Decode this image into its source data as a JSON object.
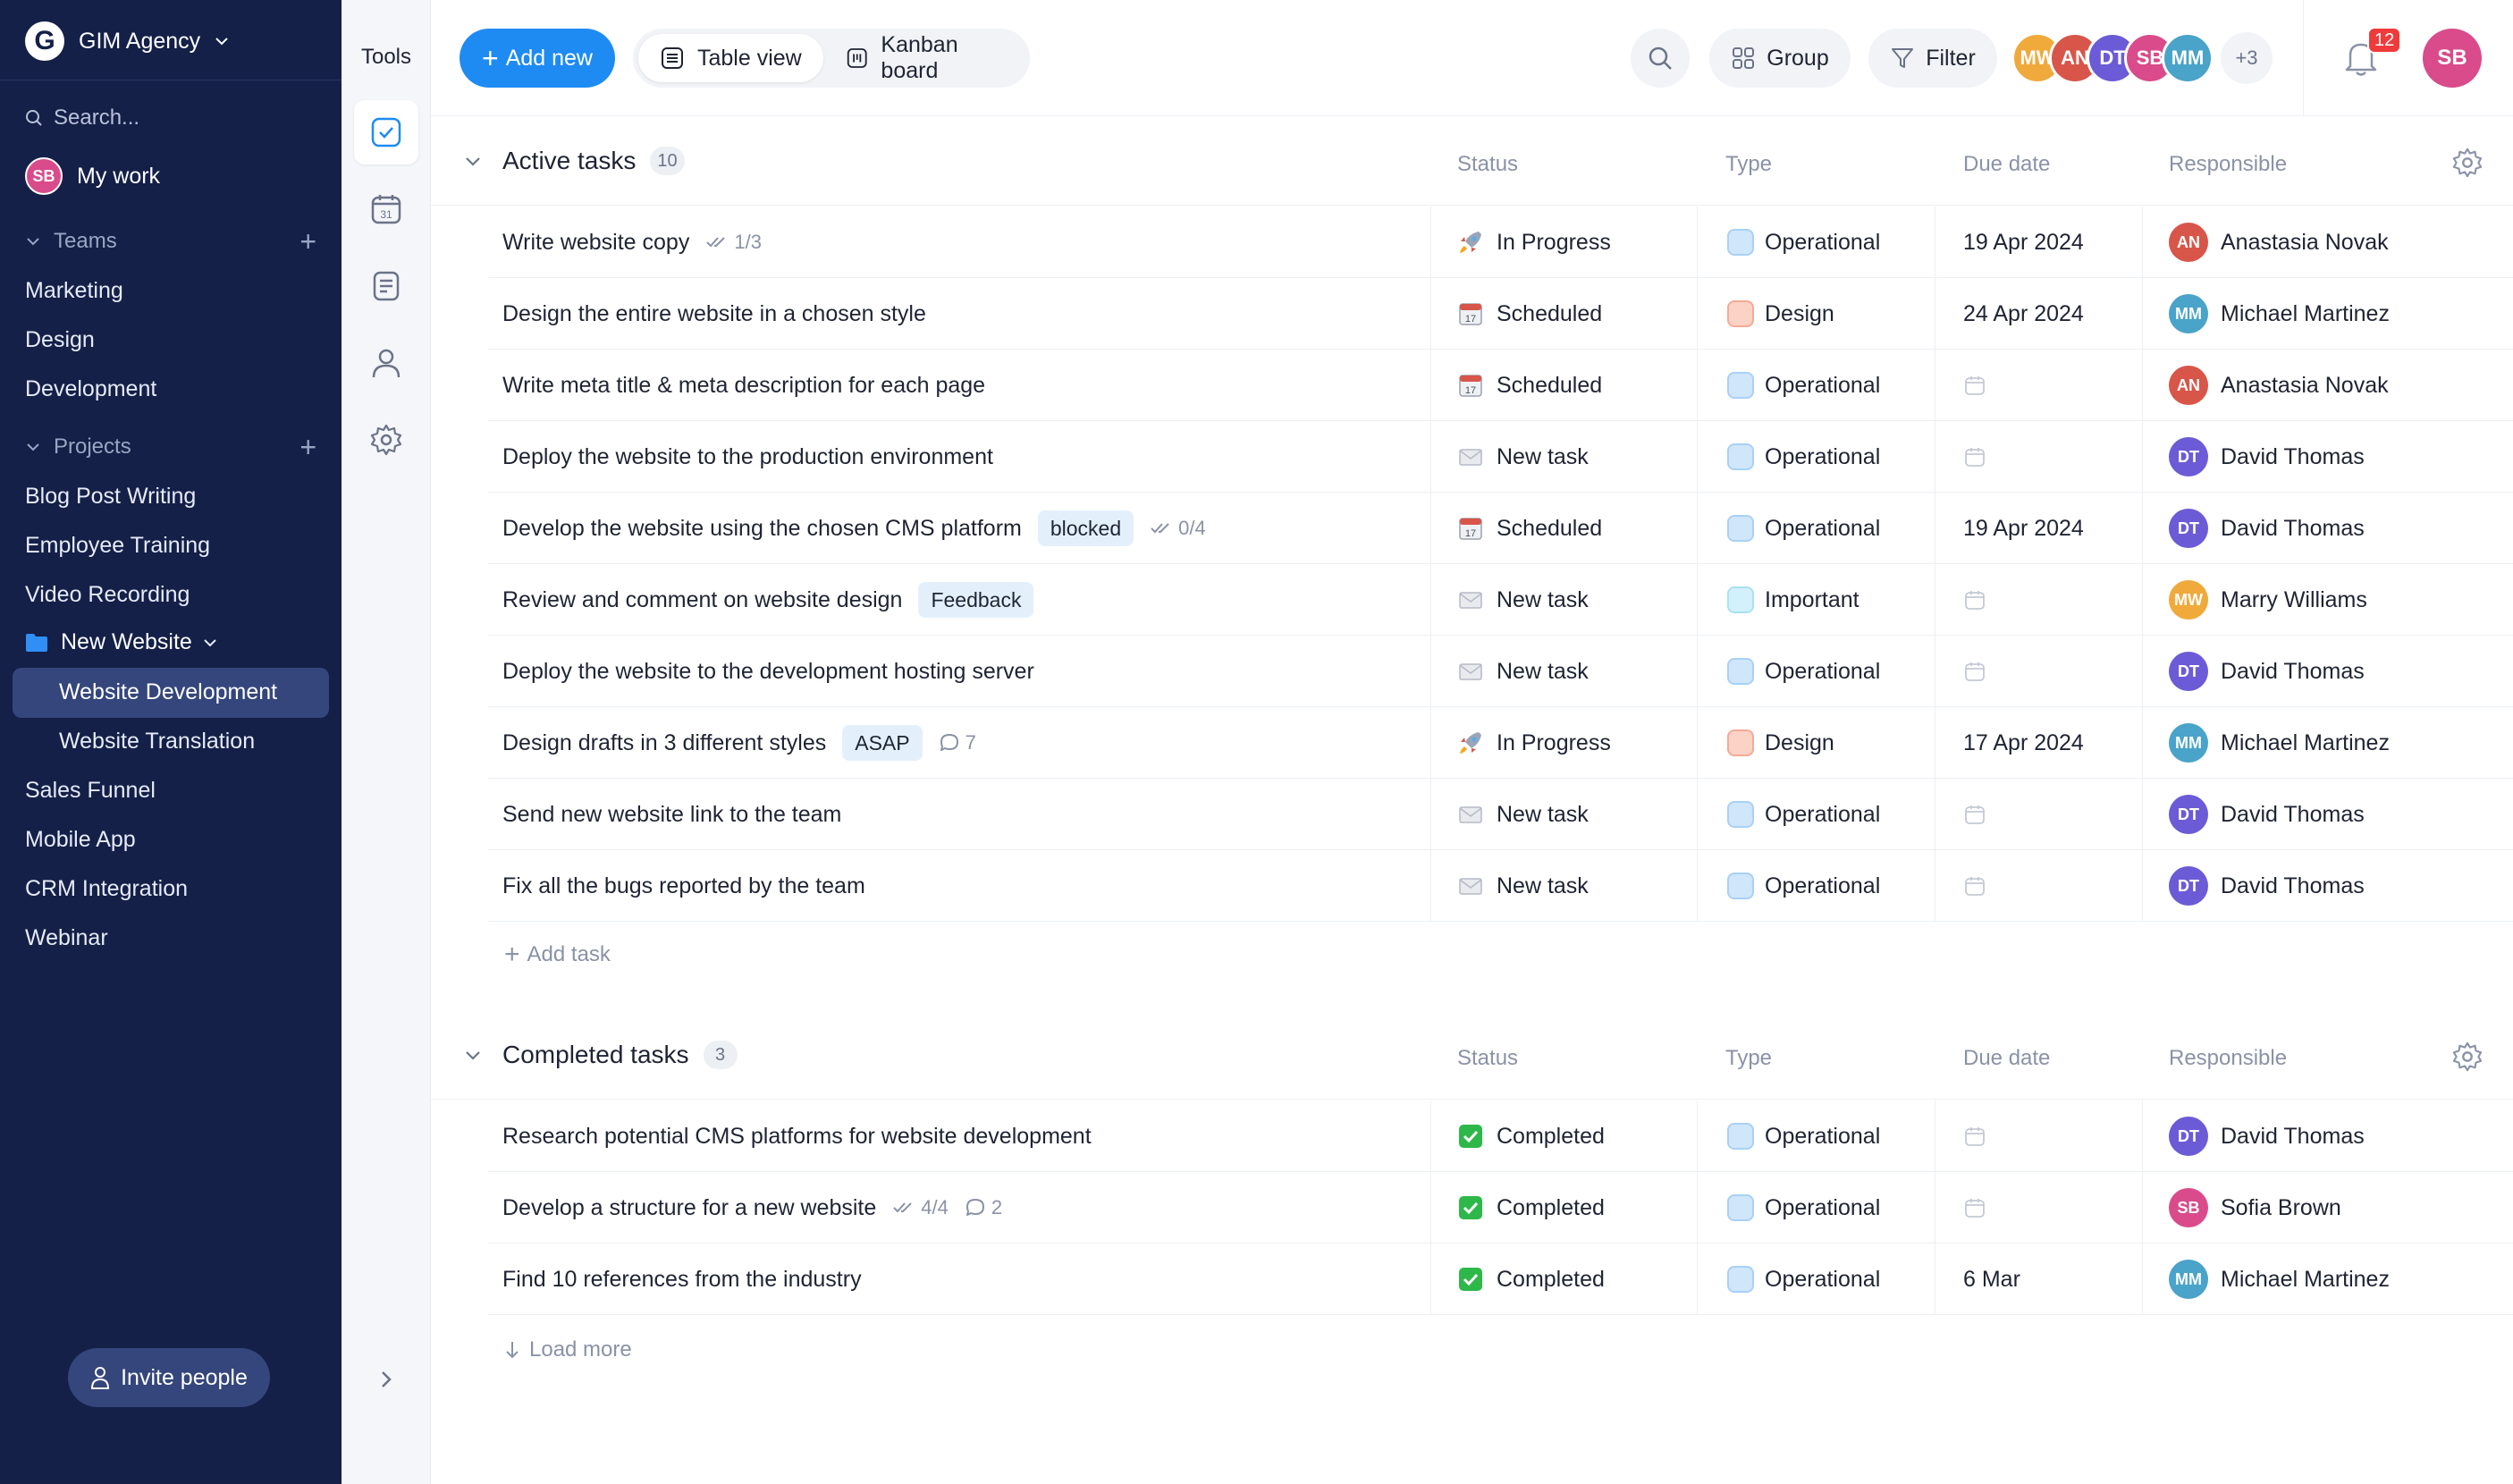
{
  "workspace": {
    "name": "GIM Agency",
    "logo_letter": "G"
  },
  "sidebar": {
    "search_placeholder": "Search...",
    "my_work": "My work",
    "teams_label": "Teams",
    "teams": [
      "Marketing",
      "Design",
      "Development"
    ],
    "projects_label": "Projects",
    "projects_before": [
      "Blog Post Writing",
      "Employee Training",
      "Video Recording"
    ],
    "folder": {
      "label": "New Website",
      "children": [
        "Website Development",
        "Website Translation"
      ],
      "active_child": "Website Development"
    },
    "projects_after": [
      "Sales Funnel",
      "Mobile App",
      "CRM Integration",
      "Webinar"
    ],
    "invite_label": "Invite people"
  },
  "tools": {
    "label": "Tools",
    "items": [
      "tasks-icon",
      "calendar-icon",
      "notes-icon",
      "people-icon",
      "settings-icon"
    ],
    "calendar_day": "31"
  },
  "toolbar": {
    "add_new": "Add new",
    "views": [
      {
        "label": "Table view",
        "selected": true
      },
      {
        "label": "Kanban board",
        "selected": false
      }
    ],
    "group": "Group",
    "filter": "Filter",
    "members": [
      {
        "initials": "MW",
        "color": "#f0a93b"
      },
      {
        "initials": "AN",
        "color": "#d8554a"
      },
      {
        "initials": "DT",
        "color": "#6b5bd6"
      },
      {
        "initials": "SB",
        "color": "#d94b8a"
      },
      {
        "initials": "MM",
        "color": "#4aa3c9"
      }
    ],
    "members_more": "+3",
    "notifications": "12",
    "me_initials": "SB"
  },
  "columns": {
    "status": "Status",
    "type": "Type",
    "due": "Due date",
    "responsible": "Responsible"
  },
  "colors": {
    "accent": "#1e8bf2",
    "sidebar_bg": "#142048",
    "type_operational": "#cfe6fb",
    "type_design": "#fbd2c6",
    "type_important": "#d3f1fb"
  },
  "active_group": {
    "title": "Active tasks",
    "count": "10",
    "add_task": "Add task",
    "rows": [
      {
        "title": "Write website copy",
        "tag": "",
        "subtasks": "1/3",
        "comments": "",
        "status": "In Progress",
        "status_icon": "rocket",
        "type": "Operational",
        "due": "19 Apr 2024",
        "resp": "Anastasia Novak",
        "resp_initials": "AN",
        "resp_color": "#d8554a"
      },
      {
        "title": "Design the entire website in a chosen style",
        "tag": "",
        "subtasks": "",
        "comments": "",
        "status": "Scheduled",
        "status_icon": "calendar",
        "type": "Design",
        "due": "24 Apr 2024",
        "resp": "Michael Martinez",
        "resp_initials": "MM",
        "resp_color": "#4aa3c9"
      },
      {
        "title": "Write meta title & meta description for each page",
        "tag": "",
        "subtasks": "",
        "comments": "",
        "status": "Scheduled",
        "status_icon": "calendar",
        "type": "Operational",
        "due": "",
        "resp": "Anastasia Novak",
        "resp_initials": "AN",
        "resp_color": "#d8554a"
      },
      {
        "title": "Deploy the website to the production environment",
        "tag": "",
        "subtasks": "",
        "comments": "",
        "status": "New task",
        "status_icon": "envelope",
        "type": "Operational",
        "due": "",
        "resp": "David Thomas",
        "resp_initials": "DT",
        "resp_color": "#6b5bd6"
      },
      {
        "title": "Develop the website using the chosen CMS platform",
        "tag": "blocked",
        "subtasks": "0/4",
        "comments": "",
        "status": "Scheduled",
        "status_icon": "calendar",
        "type": "Operational",
        "due": "19 Apr 2024",
        "resp": "David Thomas",
        "resp_initials": "DT",
        "resp_color": "#6b5bd6"
      },
      {
        "title": "Review and comment on website design",
        "tag": "Feedback",
        "subtasks": "",
        "comments": "",
        "status": "New task",
        "status_icon": "envelope",
        "type": "Important",
        "due": "",
        "resp": "Marry Williams",
        "resp_initials": "MW",
        "resp_color": "#f0a93b"
      },
      {
        "title": "Deploy the website to the development hosting server",
        "tag": "",
        "subtasks": "",
        "comments": "",
        "status": "New task",
        "status_icon": "envelope",
        "type": "Operational",
        "due": "",
        "resp": "David Thomas",
        "resp_initials": "DT",
        "resp_color": "#6b5bd6"
      },
      {
        "title": "Design drafts in 3 different styles",
        "tag": "ASAP",
        "subtasks": "",
        "comments": "7",
        "status": "In Progress",
        "status_icon": "rocket",
        "type": "Design",
        "due": "17 Apr 2024",
        "resp": "Michael Martinez",
        "resp_initials": "MM",
        "resp_color": "#4aa3c9"
      },
      {
        "title": "Send new website link to the team",
        "tag": "",
        "subtasks": "",
        "comments": "",
        "status": "New task",
        "status_icon": "envelope",
        "type": "Operational",
        "due": "",
        "resp": "David Thomas",
        "resp_initials": "DT",
        "resp_color": "#6b5bd6"
      },
      {
        "title": "Fix all the bugs reported by the team",
        "tag": "",
        "subtasks": "",
        "comments": "",
        "status": "New task",
        "status_icon": "envelope",
        "type": "Operational",
        "due": "",
        "resp": "David Thomas",
        "resp_initials": "DT",
        "resp_color": "#6b5bd6"
      }
    ]
  },
  "completed_group": {
    "title": "Completed tasks",
    "count": "3",
    "load_more": "Load more",
    "rows": [
      {
        "title": "Research potential CMS platforms for website development",
        "tag": "",
        "subtasks": "",
        "comments": "",
        "status": "Completed",
        "status_icon": "check",
        "type": "Operational",
        "due": "",
        "resp": "David Thomas",
        "resp_initials": "DT",
        "resp_color": "#6b5bd6"
      },
      {
        "title": "Develop a structure for a new website",
        "tag": "",
        "subtasks": "4/4",
        "comments": "2",
        "status": "Completed",
        "status_icon": "check",
        "type": "Operational",
        "due": "",
        "resp": "Sofia Brown",
        "resp_initials": "SB",
        "resp_color": "#d94b8a"
      },
      {
        "title": "Find 10 references from the industry",
        "tag": "",
        "subtasks": "",
        "comments": "",
        "status": "Completed",
        "status_icon": "check",
        "type": "Operational",
        "due": "6 Mar",
        "resp": "Michael Martinez",
        "resp_initials": "MM",
        "resp_color": "#4aa3c9"
      }
    ]
  }
}
